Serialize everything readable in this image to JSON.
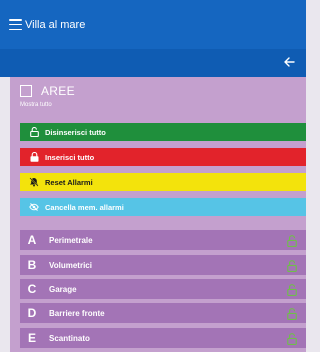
{
  "header": {
    "title": "Villa al mare"
  },
  "panel": {
    "title": "AREE",
    "show_all": "Mostra tutto",
    "actions": [
      {
        "label": "Disinserisci tutto",
        "icon": "lock-open-icon",
        "color": "#1f8f3c"
      },
      {
        "label": "Inserisci tutto",
        "icon": "lock-closed-icon",
        "color": "#e2232b"
      },
      {
        "label": "Reset Allarmi",
        "icon": "bell-off-icon",
        "color": "#f3e30c"
      },
      {
        "label": "Cancella mem. allarmi",
        "icon": "eye-off-icon",
        "color": "#56c4e6"
      }
    ],
    "areas": [
      {
        "letter": "A",
        "name": "Perimetrale",
        "icon": "lock-open-icon"
      },
      {
        "letter": "B",
        "name": "Volumetrici",
        "icon": "lock-open-icon"
      },
      {
        "letter": "C",
        "name": "Garage",
        "icon": "lock-open-icon"
      },
      {
        "letter": "D",
        "name": "Barriere fronte",
        "icon": "lock-open-icon"
      },
      {
        "letter": "E",
        "name": "Scantinato",
        "icon": "lock-open-icon"
      }
    ]
  },
  "colors": {
    "topbar": "#1566c0",
    "panel": "#c4a0ce",
    "area_row": "#a374b6",
    "lock_icon": "#6fbf4a"
  }
}
